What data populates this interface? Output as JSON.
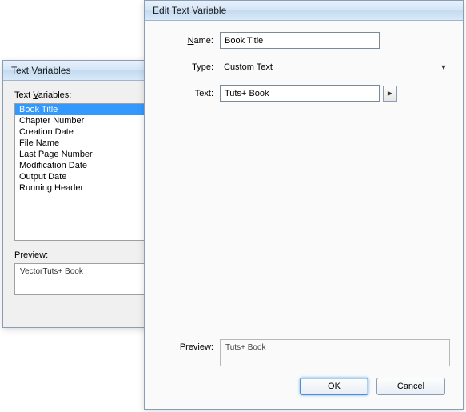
{
  "back_window": {
    "title": "Text Variables",
    "list_label_pre": "Text ",
    "list_label_ul": "V",
    "list_label_post": "ariables:",
    "items": [
      "Book Title",
      "Chapter Number",
      "Creation Date",
      "File Name",
      "Last Page Number",
      "Modification Date",
      "Output Date",
      "Running Header"
    ],
    "selected_index": 0,
    "preview_label": "Preview:",
    "preview_value": "VectorTuts+ Book"
  },
  "front_window": {
    "title": "Edit Text Variable",
    "name_label_ul": "N",
    "name_label_post": "ame:",
    "name_value": "Book Title",
    "type_label": "Type:",
    "type_value": "Custom Text",
    "text_label": "Text:",
    "text_value": "Tuts+ Book",
    "preview_label": "Preview:",
    "preview_value": "Tuts+ Book",
    "ok": "OK",
    "cancel": "Cancel"
  }
}
